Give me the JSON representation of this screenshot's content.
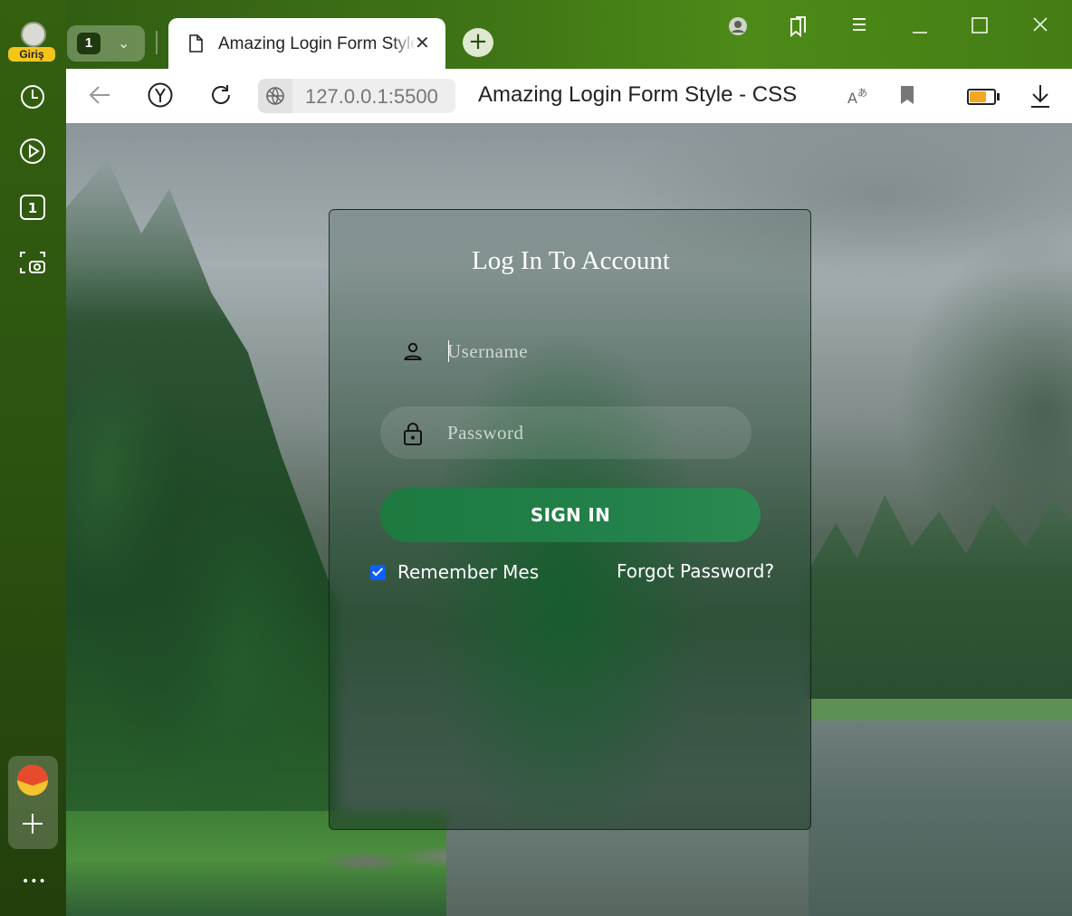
{
  "browser": {
    "profile_badge": "Giriş",
    "tab_count": "1",
    "active_tab": {
      "title": "Amazing Login Form Style - CSS"
    },
    "address": {
      "url": "127.0.0.1:5500",
      "page_title": "Amazing Login Form Style - CSS"
    },
    "battery_level": 0.7
  },
  "sidebar": {
    "items": [
      {
        "icon": "history-icon"
      },
      {
        "icon": "play-icon"
      },
      {
        "icon": "tab-one-icon",
        "label": "1"
      },
      {
        "icon": "screenshot-icon"
      }
    ],
    "more": "•••"
  },
  "login": {
    "title": "Log In To Account",
    "username": {
      "placeholder": "Username",
      "value": ""
    },
    "password": {
      "placeholder": "Password",
      "value": ""
    },
    "submit_label": "SIGN IN",
    "remember_label": "Remember Mes",
    "remember_checked": true,
    "forgot_label": "Forgot Password?"
  }
}
